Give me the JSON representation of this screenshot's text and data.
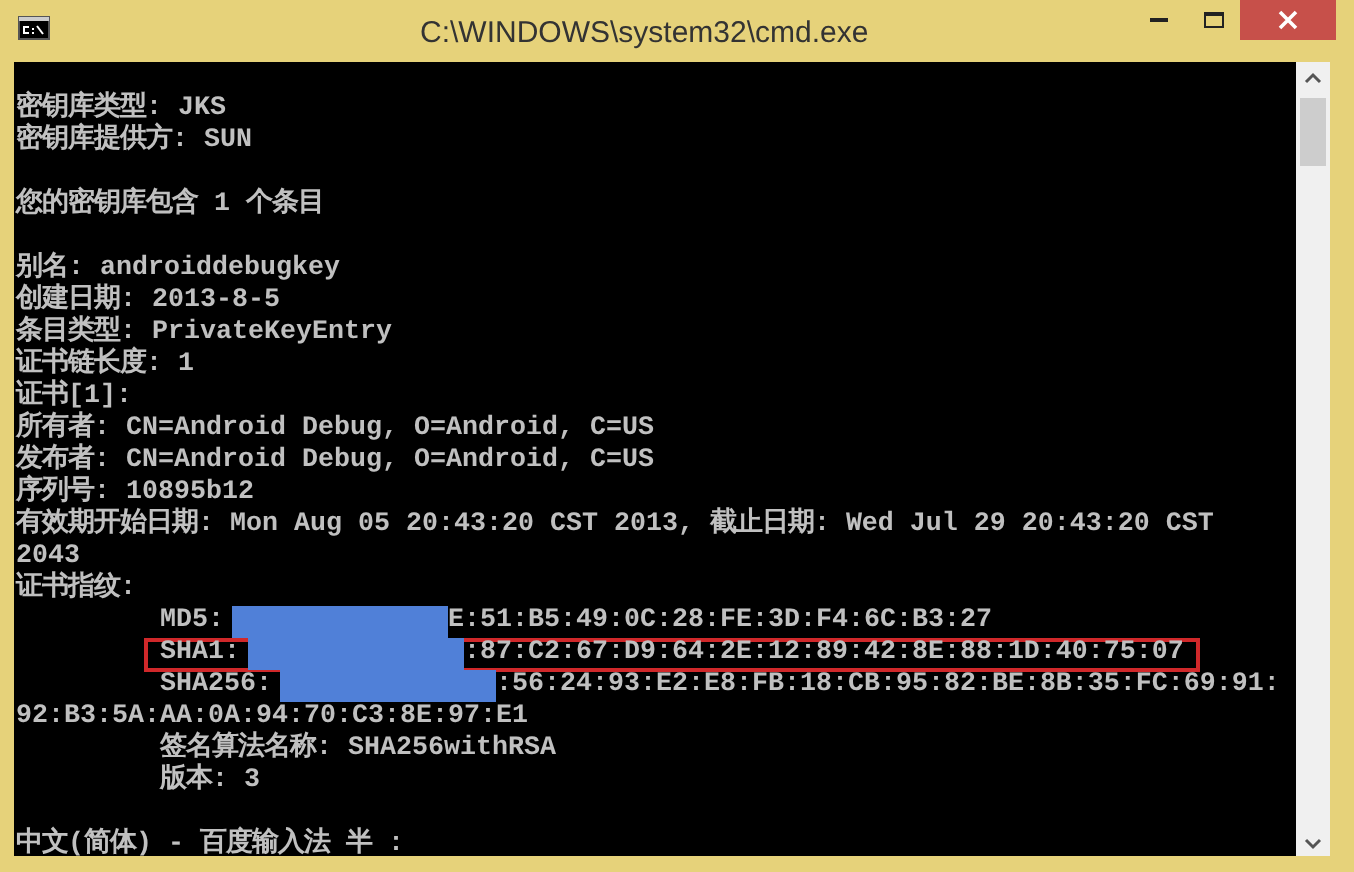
{
  "window": {
    "title": "C:\\WINDOWS\\system32\\cmd.exe"
  },
  "blocks": [
    [
      {
        "segments": [
          {
            "kind": "text",
            "text": "密钥库类型: JKS"
          }
        ],
        "highlighted": false
      },
      {
        "segments": [
          {
            "kind": "text",
            "text": "密钥库提供方: SUN"
          }
        ],
        "highlighted": false
      }
    ],
    [
      {
        "segments": [
          {
            "kind": "text",
            "text": "您的密钥库包含 1 个条目"
          }
        ],
        "highlighted": false
      }
    ],
    [
      {
        "segments": [
          {
            "kind": "text",
            "text": "别名: androiddebugkey"
          }
        ],
        "highlighted": false
      },
      {
        "segments": [
          {
            "kind": "text",
            "text": "创建日期: 2013-8-5"
          }
        ],
        "highlighted": false
      },
      {
        "segments": [
          {
            "kind": "text",
            "text": "条目类型: PrivateKeyEntry"
          }
        ],
        "highlighted": false
      },
      {
        "segments": [
          {
            "kind": "text",
            "text": "证书链长度: 1"
          }
        ],
        "highlighted": false
      },
      {
        "segments": [
          {
            "kind": "text",
            "text": "证书[1]:"
          }
        ],
        "highlighted": false
      },
      {
        "segments": [
          {
            "kind": "text",
            "text": "所有者: CN=Android Debug, O=Android, C=US"
          }
        ],
        "highlighted": false
      },
      {
        "segments": [
          {
            "kind": "text",
            "text": "发布者: CN=Android Debug, O=Android, C=US"
          }
        ],
        "highlighted": false
      },
      {
        "segments": [
          {
            "kind": "text",
            "text": "序列号: 10895b12"
          }
        ],
        "highlighted": false
      },
      {
        "segments": [
          {
            "kind": "text",
            "text": "有效期开始日期: Mon Aug 05 20:43:20 CST 2013, 截止日期: Wed Jul 29 20:43:20 CST"
          }
        ],
        "highlighted": false
      },
      {
        "segments": [
          {
            "kind": "text",
            "text": "2043"
          }
        ],
        "highlighted": false
      },
      {
        "segments": [
          {
            "kind": "text",
            "text": "证书指纹:"
          }
        ],
        "highlighted": false,
        "children": [
          {
            "segments": [
              {
                "kind": "text",
                "text": "MD5:"
              },
              {
                "kind": "redacted"
              },
              {
                "kind": "text",
                "text": "E:51:B5:49:0C:28:FE:3D:F4:6C:B3:27"
              }
            ],
            "highlighted": false
          },
          {
            "segments": [
              {
                "kind": "text",
                "text": "SHA1:"
              },
              {
                "kind": "redacted"
              },
              {
                "kind": "text",
                "text": ":87:C2:67:D9:64:2E:12:89:42:8E:88:1D:40:75:07"
              }
            ],
            "highlighted": true
          },
          {
            "segments": [
              {
                "kind": "text",
                "text": "SHA256:"
              },
              {
                "kind": "redacted"
              },
              {
                "kind": "text",
                "text": ":56:24:93:E2:E8:FB:18:CB:95:82:BE:8B:35:FC:69:91:"
              }
            ],
            "highlighted": false,
            "continuation": "92:B3:5A:AA:0A:94:70:C3:8E:97:E1"
          },
          {
            "segments": [
              {
                "kind": "text",
                "text": "签名算法名称: SHA256withRSA"
              }
            ],
            "highlighted": false
          },
          {
            "segments": [
              {
                "kind": "text",
                "text": "版本: 3"
              }
            ],
            "highlighted": false
          }
        ]
      }
    ]
  ],
  "ime_status": "中文(简体) - 百度输入法 半 :"
}
